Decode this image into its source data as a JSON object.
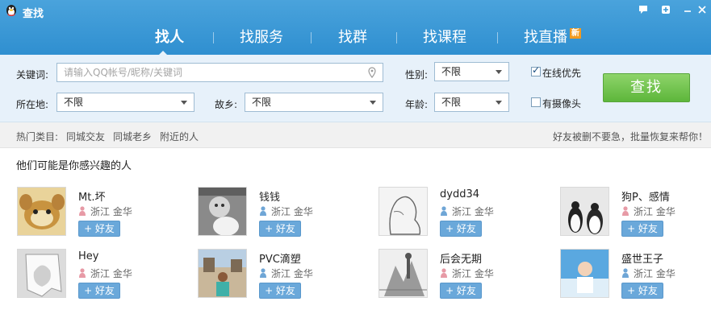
{
  "window": {
    "title": "查找"
  },
  "tabs": [
    {
      "label": "找人",
      "active": true
    },
    {
      "label": "找服务",
      "active": false
    },
    {
      "label": "找群",
      "active": false
    },
    {
      "label": "找课程",
      "active": false
    },
    {
      "label": "找直播",
      "active": false,
      "badge": "新"
    }
  ],
  "search": {
    "keyword_label": "关键词:",
    "keyword_placeholder": "请输入QQ帐号/昵称/关键词",
    "keyword_value": "",
    "gender_label": "性别:",
    "gender_value": "不限",
    "location_label": "所在地:",
    "location_value": "不限",
    "hometown_label": "故乡:",
    "hometown_value": "不限",
    "age_label": "年龄:",
    "age_value": "不限",
    "online_first_label": "在线优先",
    "online_first_checked": true,
    "has_camera_label": "有摄像头",
    "has_camera_checked": false,
    "search_button": "查找"
  },
  "hot": {
    "label": "热门类目:",
    "items": [
      "同城交友",
      "同城老乡",
      "附近的人"
    ],
    "promo": "好友被删不要急，批量恢复来帮你！"
  },
  "suggestions": {
    "title": "他们可能是你感兴趣的人",
    "add_label": "+ 好友",
    "people": [
      {
        "nick": "Mt.坏",
        "location": "浙江 金华",
        "gender": "female"
      },
      {
        "nick": "钱钱",
        "location": "浙江 金华",
        "gender": "male"
      },
      {
        "nick": "dydd34",
        "location": "浙江 金华",
        "gender": "male"
      },
      {
        "nick": "狗P、感情",
        "location": "浙江 金华",
        "gender": "female"
      },
      {
        "nick": "Hey",
        "location": "浙江 金华",
        "gender": "female"
      },
      {
        "nick": "PVC滴塑",
        "location": "浙江 金华",
        "gender": "male"
      },
      {
        "nick": "后会无期",
        "location": "浙江 金华",
        "gender": "female"
      },
      {
        "nick": "盛世王子",
        "location": "浙江 金华",
        "gender": "male"
      }
    ]
  },
  "colors": {
    "header": "#3a98d6",
    "panel": "#e7f1fa",
    "search_button": "#6cc045",
    "male": "#6fa6d6",
    "female": "#e79aa6"
  }
}
